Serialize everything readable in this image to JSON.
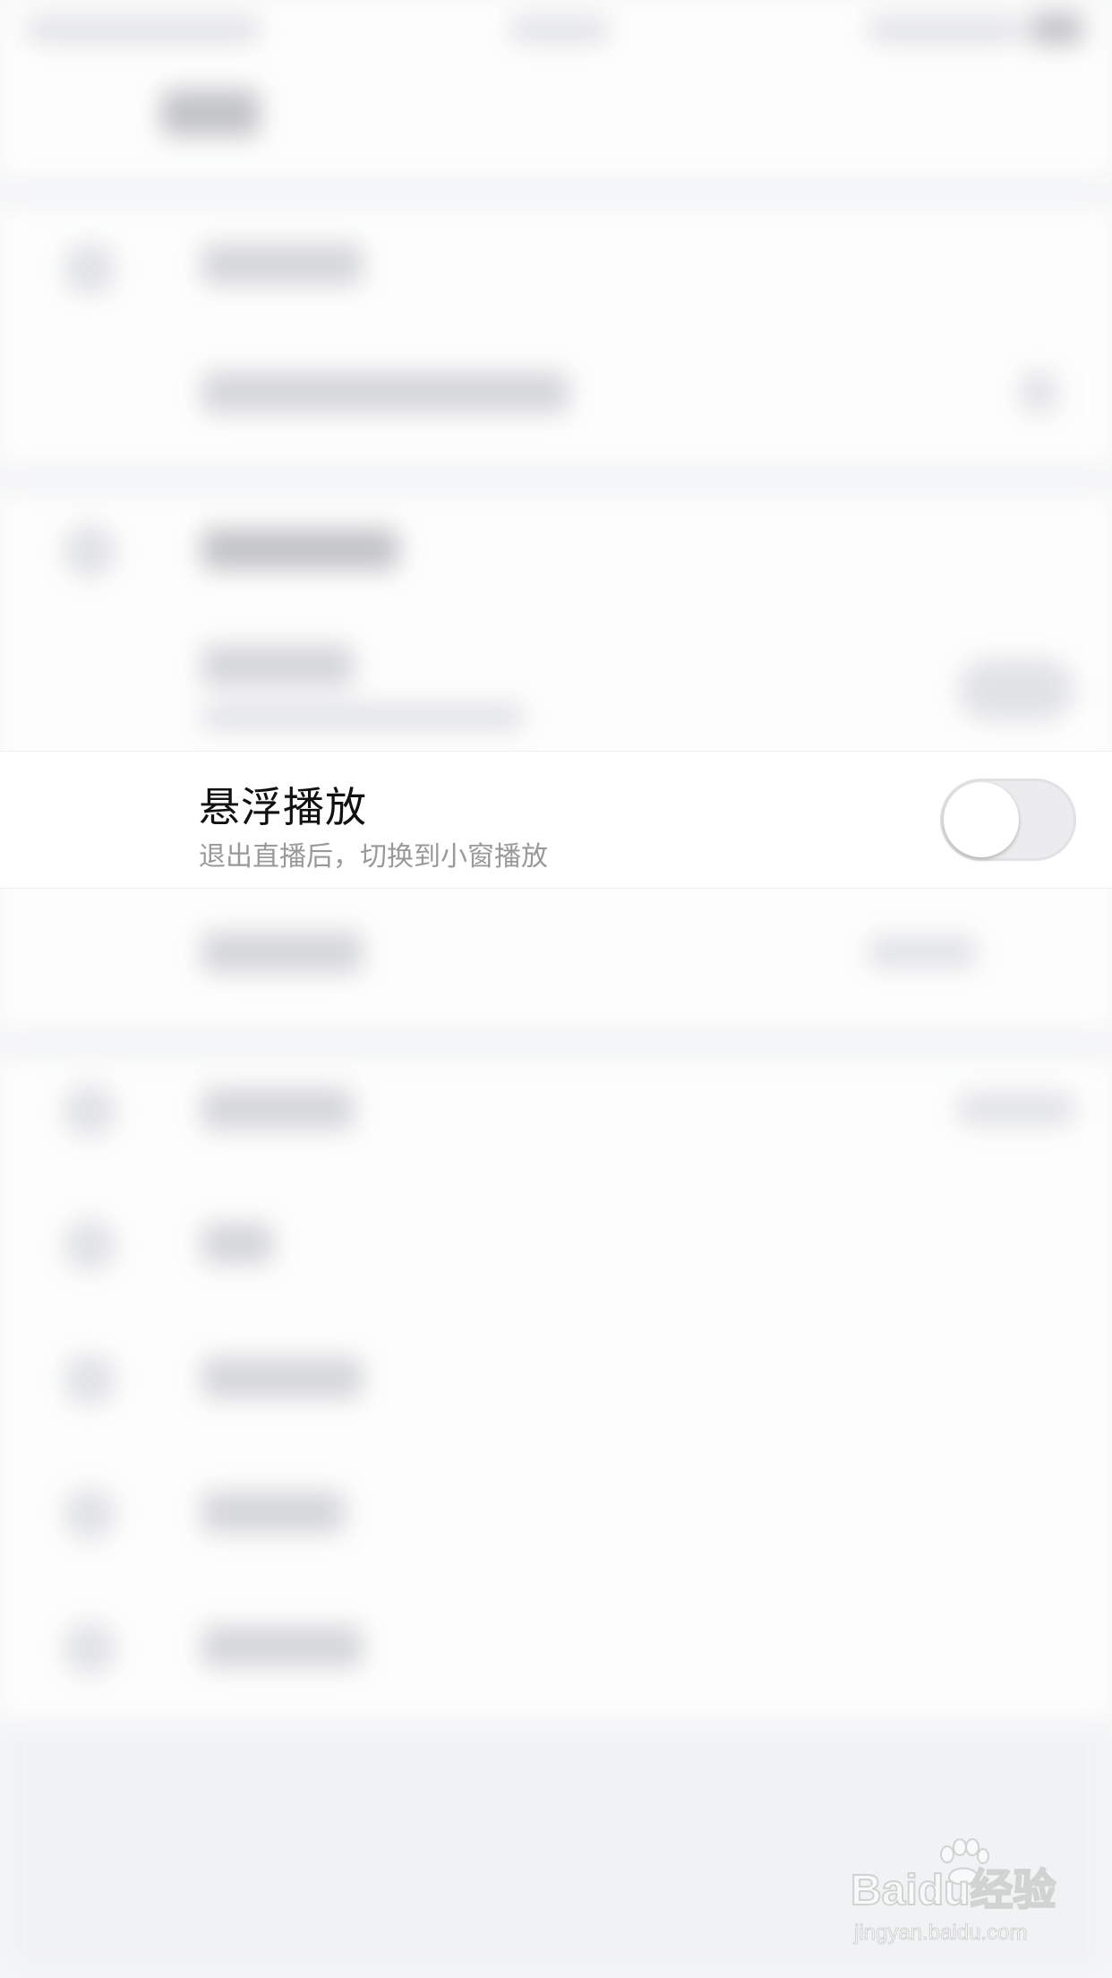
{
  "settings_row": {
    "title": "悬浮播放",
    "subtitle": "退出直播后，切换到小窗播放",
    "toggle_state": "off"
  },
  "watermark": {
    "logo_text": "Baidu经验",
    "url_text": "jingyan.baidu.com"
  },
  "colors": {
    "toggle_off_track": "#ececee",
    "subtitle_text": "#999999",
    "title_text": "#111111"
  }
}
